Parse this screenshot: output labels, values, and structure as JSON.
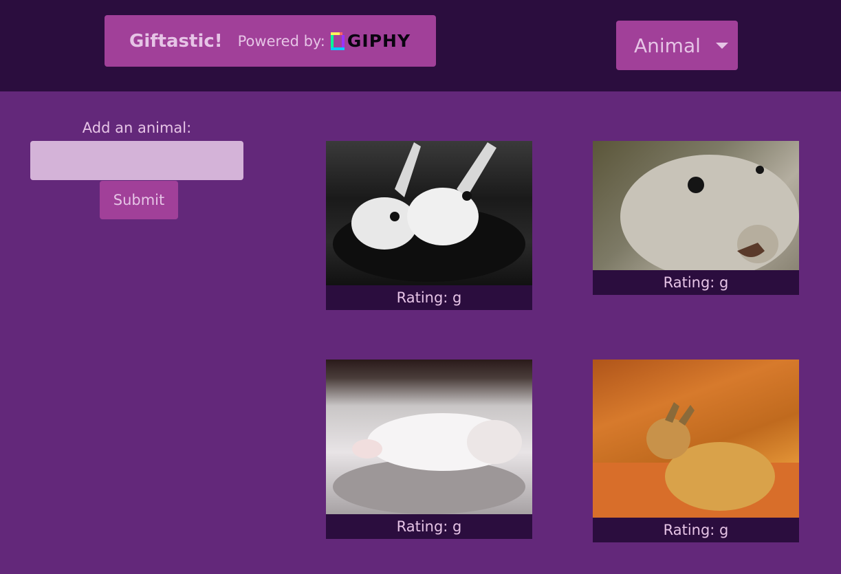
{
  "header": {
    "brand_name": "Giftastic!",
    "powered_by": "Powered by:",
    "giphy_logo_text": "GIPHY",
    "dropdown_label": "Animal"
  },
  "form": {
    "label": "Add an animal:",
    "input_value": "",
    "input_placeholder": "",
    "submit_label": "Submit"
  },
  "gifs": [
    {
      "rating": "Rating: g"
    },
    {
      "rating": "Rating: g"
    },
    {
      "rating": "Rating: g"
    },
    {
      "rating": "Rating: g"
    }
  ],
  "colors": {
    "top_bar": "#2b0d3e",
    "page_background": "#63287a",
    "accent": "#a14099",
    "text": "#e6c4e6"
  }
}
